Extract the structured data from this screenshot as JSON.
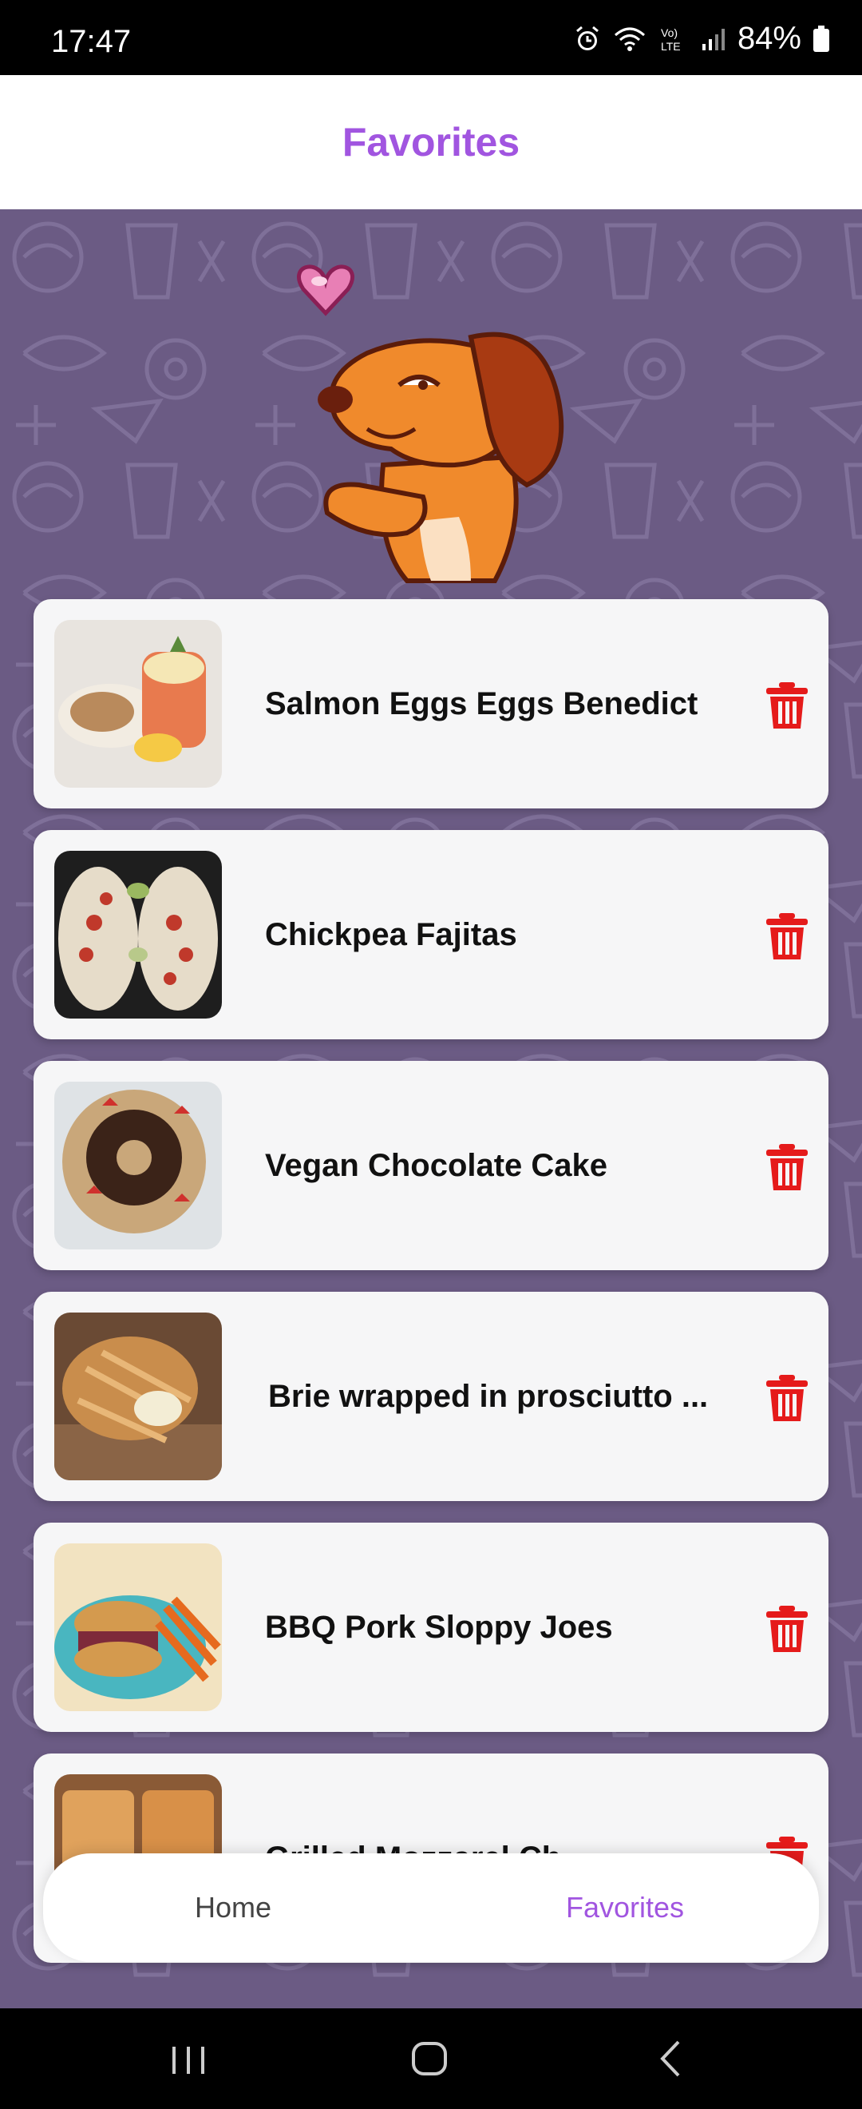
{
  "status_bar": {
    "time": "17:47",
    "battery": "84%",
    "icons": [
      "alarm-icon",
      "wifi-icon",
      "volte-icon",
      "signal-icon",
      "battery-icon"
    ]
  },
  "header": {
    "title": "Favorites"
  },
  "favorites": [
    {
      "title": "Salmon Eggs Eggs Benedict"
    },
    {
      "title": "Chickpea Fajitas"
    },
    {
      "title": "Vegan Chocolate Cake"
    },
    {
      "title": "Brie wrapped in prosciutto ..."
    },
    {
      "title": "BBQ Pork Sloppy Joes"
    },
    {
      "title": "Grilled Mozzarel Ch..."
    }
  ],
  "bottom_nav": {
    "home_label": "Home",
    "favorites_label": "Favorites"
  },
  "colors": {
    "accent": "#a155e0",
    "background": "#6b5b84",
    "delete": "#e51b1b"
  }
}
